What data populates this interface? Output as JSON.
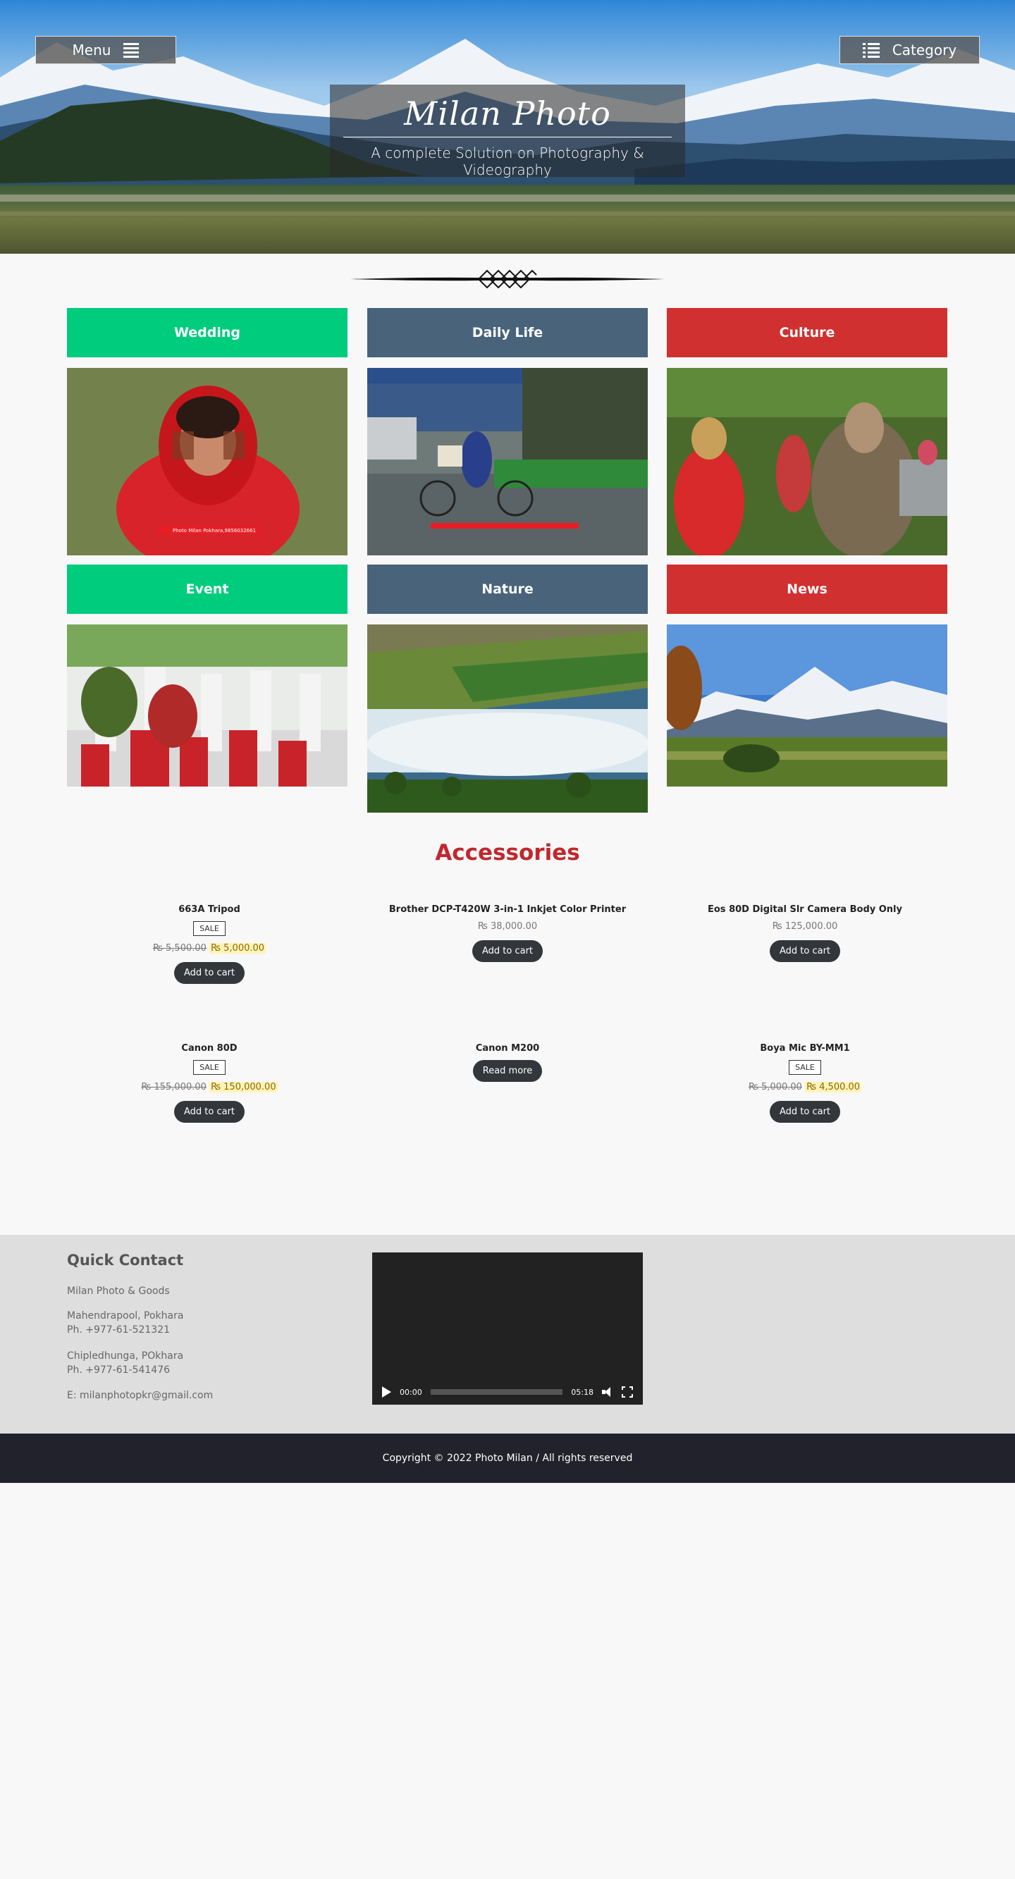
{
  "header": {
    "menu_label": "Menu",
    "category_label": "Category",
    "site_title": "Milan Photo",
    "tagline": "A complete Solution on Photography & Videography"
  },
  "categories": [
    {
      "label": "Wedding",
      "color": "#00cc7e"
    },
    {
      "label": "Daily Life",
      "color": "#48637a"
    },
    {
      "label": "Culture",
      "color": "#d0302f"
    },
    {
      "label": "Event",
      "color": "#00cc7e"
    },
    {
      "label": "Nature",
      "color": "#48637a"
    },
    {
      "label": "News",
      "color": "#d0302f"
    }
  ],
  "accessories": {
    "title": "Accessories",
    "products": [
      {
        "name": "663A Tripod",
        "sale_badge": "SALE",
        "old_price": "₨ 5,500.00",
        "new_price": "₨ 5,000.00",
        "button": "Add to cart"
      },
      {
        "name": "Brother DCP-T420W 3-in-1 Inkjet Color Printer",
        "price": "₨ 38,000.00",
        "button": "Add to cart"
      },
      {
        "name": "Eos 80D Digital Slr Camera Body Only",
        "price": "₨ 125,000.00",
        "button": "Add to cart"
      },
      {
        "name": "Canon 80D",
        "sale_badge": "SALE",
        "old_price": "₨ 155,000.00",
        "new_price": "₨ 150,000.00",
        "button": "Add to cart"
      },
      {
        "name": "Canon M200",
        "button": "Read more"
      },
      {
        "name": "Boya Mic BY-MM1",
        "sale_badge": "SALE",
        "old_price": "₨ 5,000.00",
        "new_price": "₨ 4,500.00",
        "button": "Add to cart"
      }
    ]
  },
  "footer": {
    "quick_contact_title": "Quick Contact",
    "business_name": "Milan Photo & Goods",
    "address1_line1": "Mahendrapool, Pokhara",
    "address1_line2": "Ph. +977-61-521321",
    "address2_line1": "Chipledhunga, POkhara",
    "address2_line2": "Ph. +977-61-541476",
    "email": "E: milanphotopkr@gmail.com",
    "video": {
      "current_time": "00:00",
      "duration": "05:18"
    },
    "copyright": "Copyright © 2022 Photo Milan / All rights reserved"
  },
  "image_captions": {
    "wedding": "Photo Milan Pokhara,9856032661"
  }
}
